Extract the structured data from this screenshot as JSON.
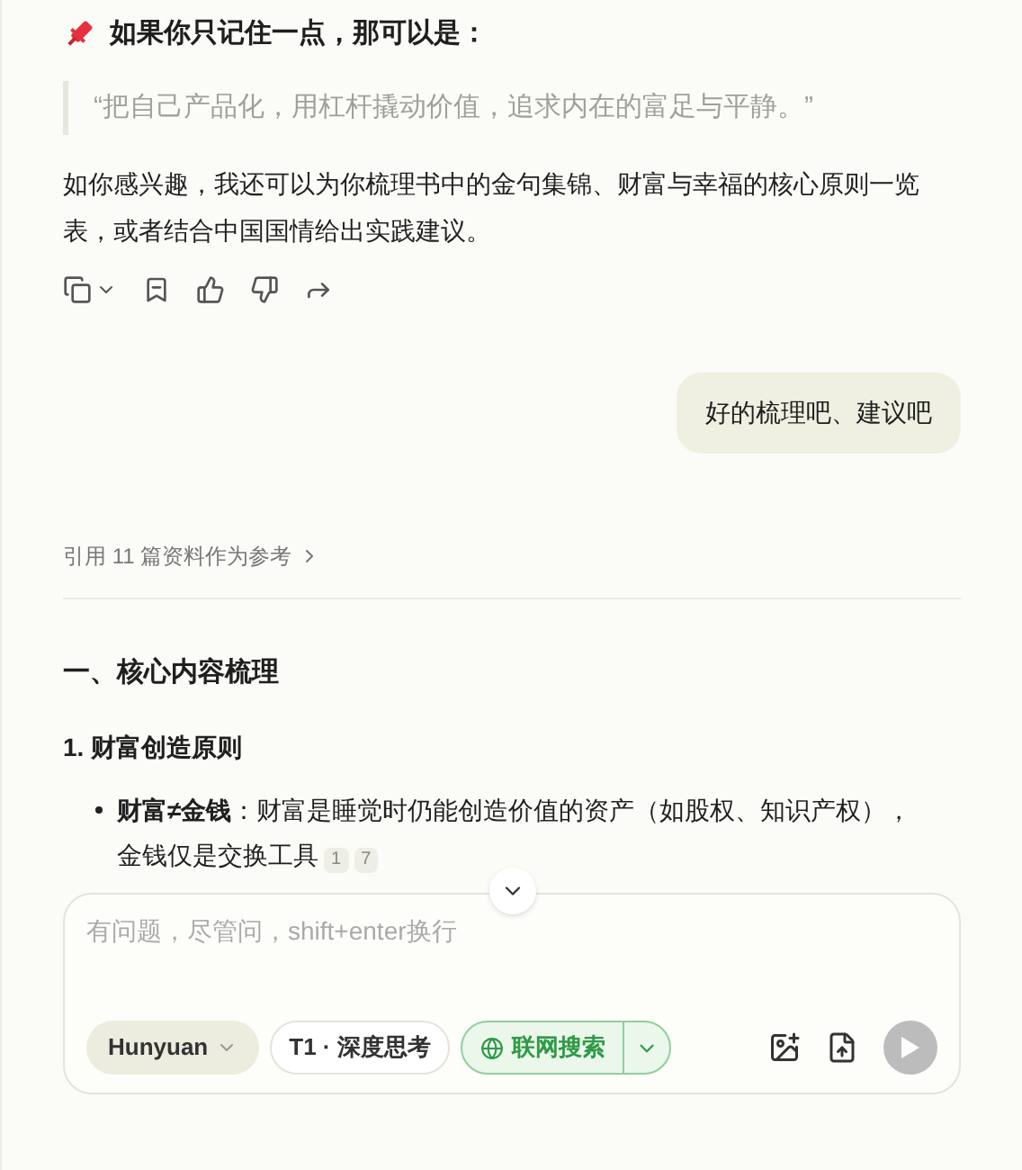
{
  "answer_top": {
    "heading": "如果你只记住一点，那可以是：",
    "quote": "“把自己产品化，用杠杆撬动价值，追求内在的富足与平静。”",
    "paragraph": "如你感兴趣，我还可以为你梳理书中的金句集锦、财富与幸福的核心原则一览表，或者结合中国国情给出实践建议。"
  },
  "user_message": "好的梳理吧、建议吧",
  "references": "引用 11 篇资料作为参考",
  "answer": {
    "section_title": "一、核心内容梳理",
    "subsection_title": "1. 财富创造原则",
    "bullets": [
      {
        "term": "财富≠金钱",
        "separator": "：",
        "text": "财富是睡觉时仍能创造价值的资产（如股权、知识产权），金钱仅是交换工具",
        "citations": [
          "1",
          "7"
        ]
      }
    ]
  },
  "composer": {
    "placeholder": "有问题，尽管问，shift+enter换行",
    "model": "Hunyuan",
    "modes": [
      {
        "label": "T1 · 深度思考",
        "selected": false
      },
      {
        "label": "联网搜索",
        "selected": true
      }
    ]
  }
}
